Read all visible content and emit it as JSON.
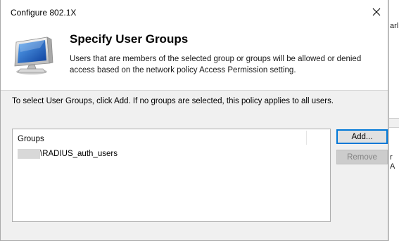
{
  "dialog": {
    "title": "Configure 802.1X",
    "close_glyph": "✕",
    "header_title": "Specify User Groups",
    "header_description": "Users that are members of the selected group or groups will be allowed or denied access based on the network policy Access Permission setting.",
    "instruction": "To select User Groups, click Add. If no groups are selected, this policy applies to all users."
  },
  "groups": {
    "column_header": "Groups",
    "items": [
      {
        "name": "\\RADIUS_auth_users"
      }
    ]
  },
  "buttons": {
    "add_label": "Add...",
    "remove_label": "Remove"
  },
  "background_window": {
    "text_top": "arl",
    "text_a": "r",
    "text_b": "A"
  },
  "colors": {
    "accent": "#0078d7",
    "dialog_bg": "#f0f0f0",
    "panel_bg": "#ffffff",
    "disabled_text": "#838383"
  },
  "icons": {
    "header": "monitor-icon",
    "close": "close-icon"
  }
}
